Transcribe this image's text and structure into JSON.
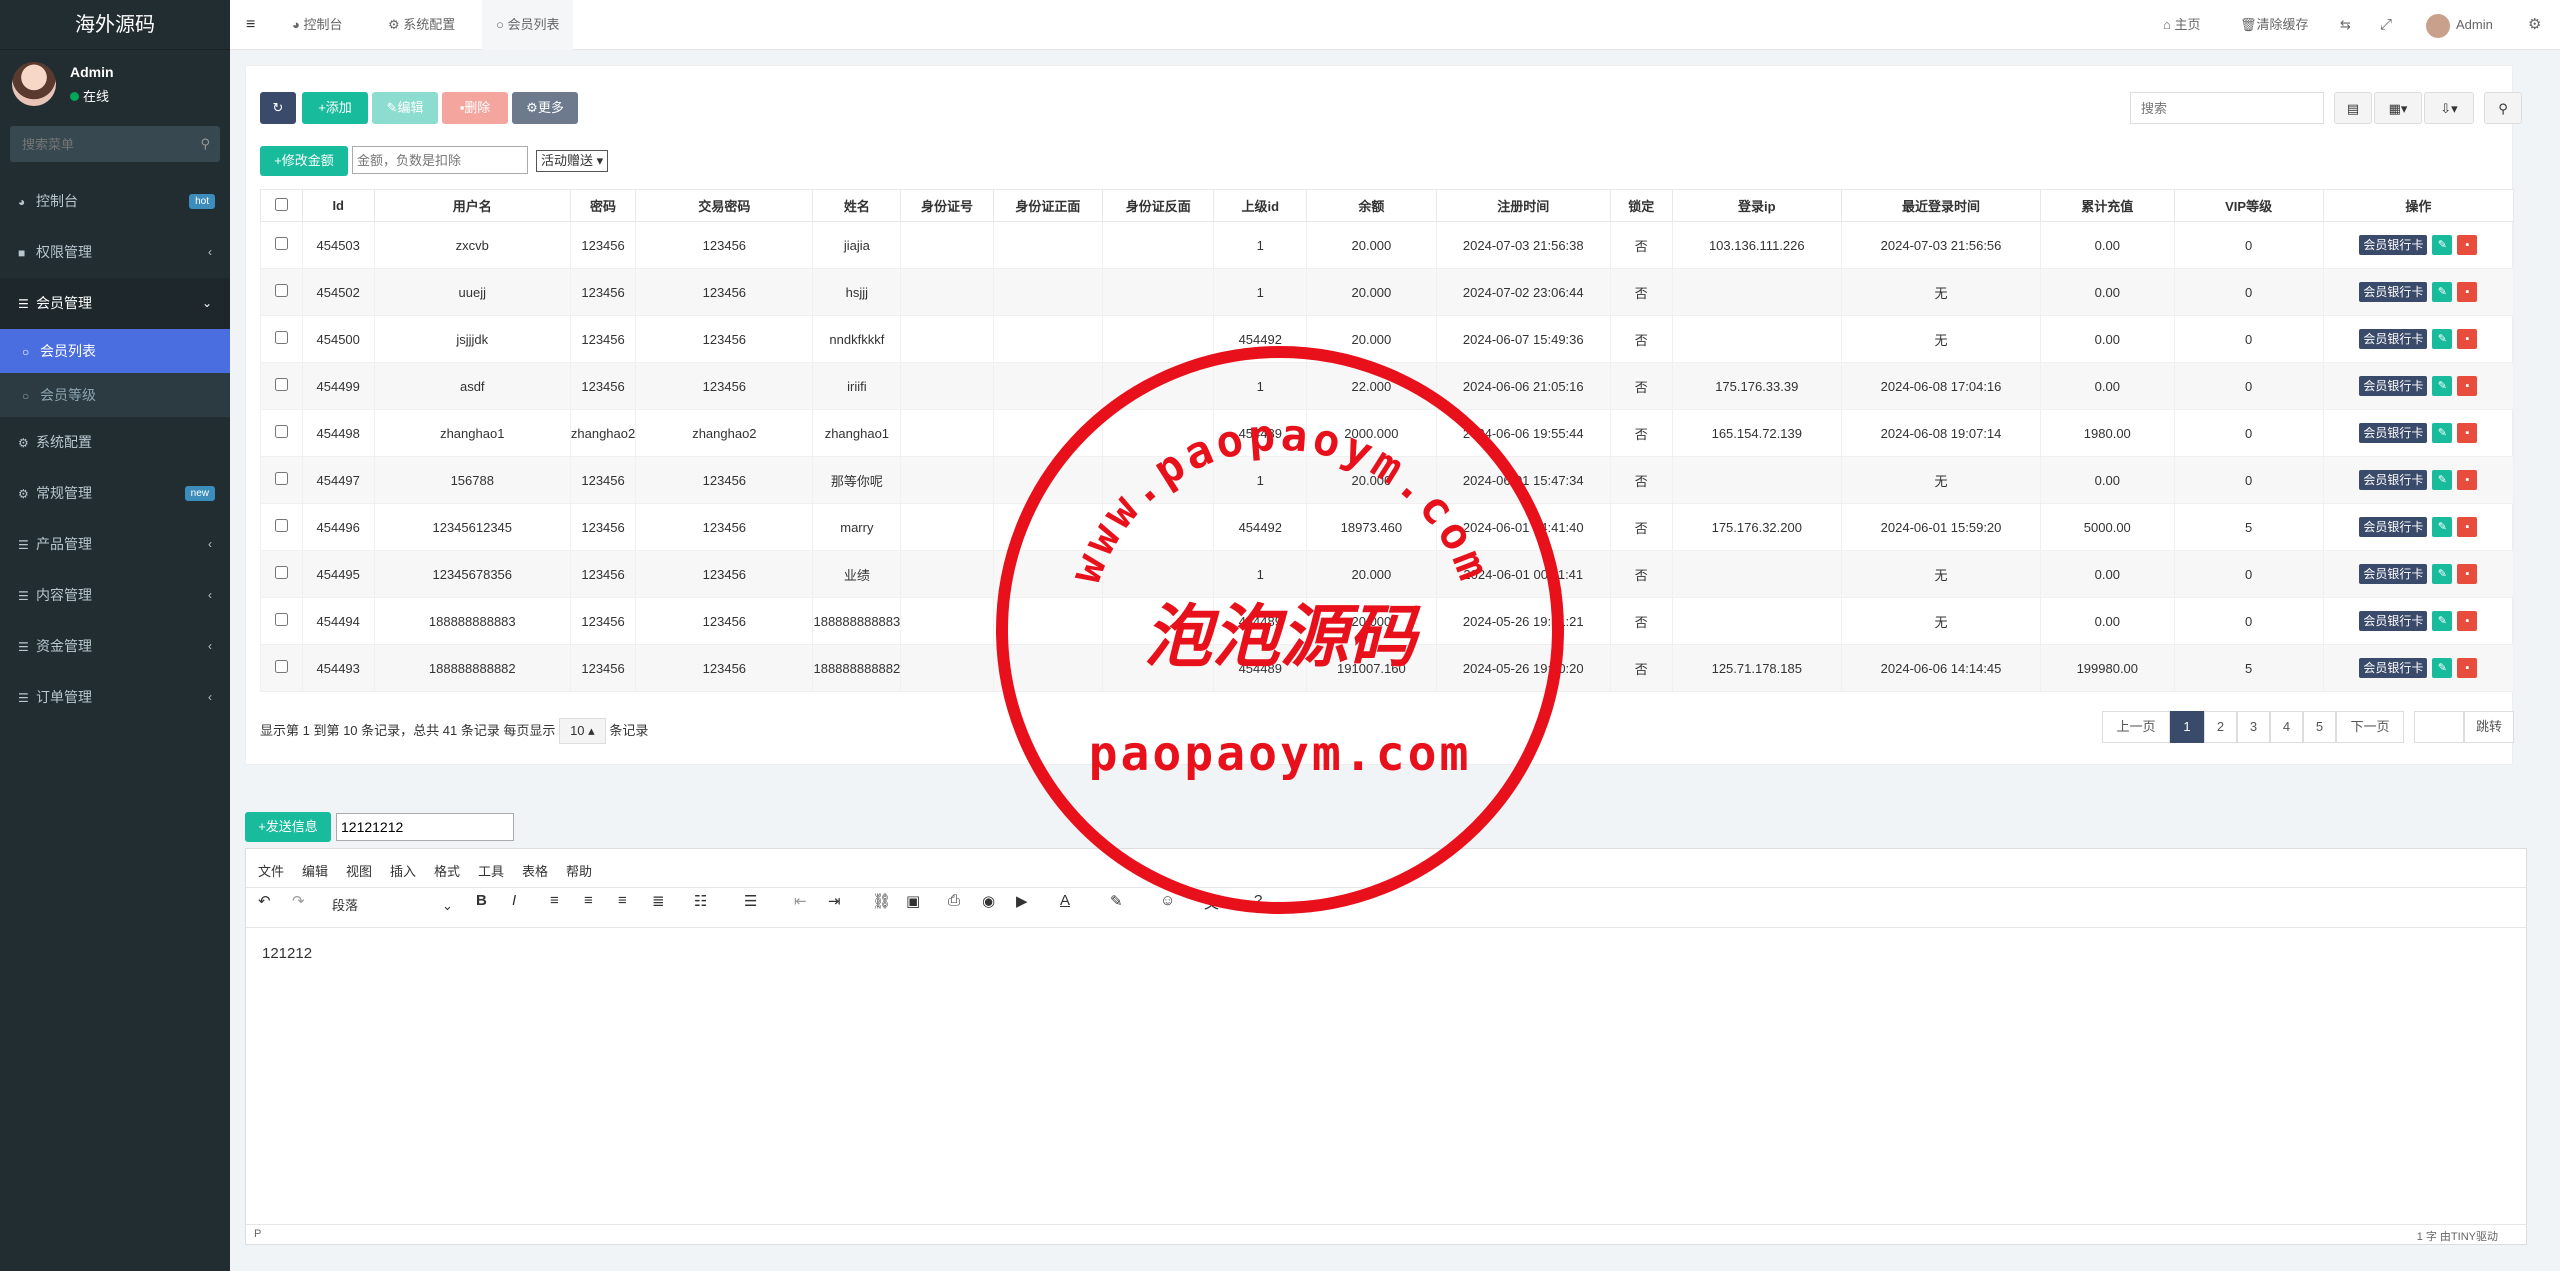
{
  "sidebar": {
    "logo": "海外源码",
    "user": {
      "name": "Admin",
      "status": "在线"
    },
    "search_placeholder": "搜索菜单",
    "items": [
      {
        "label": "控制台",
        "badge": "hot",
        "badge_color": "#3c8dbc"
      },
      {
        "label": "权限管理",
        "arrow": "‹"
      },
      {
        "label": "会员管理",
        "arrow": "⌄"
      },
      {
        "label": "会员列表"
      },
      {
        "label": "会员等级"
      },
      {
        "label": "系统配置"
      },
      {
        "label": "常规管理",
        "badge": "new",
        "badge_color": "#3c8dbc"
      },
      {
        "label": "产品管理",
        "arrow": "‹"
      },
      {
        "label": "内容管理",
        "arrow": "‹"
      },
      {
        "label": "资金管理",
        "arrow": "‹"
      },
      {
        "label": "订单管理",
        "arrow": "‹"
      }
    ]
  },
  "topbar": {
    "tabs": [
      "控制台",
      "系统配置",
      "会员列表"
    ],
    "home": "主页",
    "clear_cache": "清除缓存",
    "admin": "Admin"
  },
  "toolbar": {
    "add": "添加",
    "edit": "编辑",
    "delete": "删除",
    "more": "更多",
    "modify_amount": "修改金额",
    "amount_placeholder": "金额，负数是扣除",
    "activity_select": "活动赠送",
    "search_placeholder": "搜索"
  },
  "table": {
    "headers": [
      "Id",
      "用户名",
      "密码",
      "交易密码",
      "姓名",
      "身份证号",
      "身份证正面",
      "身份证反面",
      "上级id",
      "余额",
      "注册时间",
      "锁定",
      "登录ip",
      "最近登录时间",
      "累计充值",
      "VIP等级",
      "操作"
    ],
    "rows": [
      [
        "454503",
        "zxcvb",
        "123456",
        "123456",
        "jiajia",
        "",
        "",
        "",
        "1",
        "20.000",
        "2024-07-03 21:56:38",
        "否",
        "103.136.111.226",
        "2024-07-03 21:56:56",
        "0.00",
        "0"
      ],
      [
        "454502",
        "uuejj",
        "123456",
        "123456",
        "hsjjj",
        "",
        "",
        "",
        "1",
        "20.000",
        "2024-07-02 23:06:44",
        "否",
        "",
        "无",
        "0.00",
        "0"
      ],
      [
        "454500",
        "jsjjjdk",
        "123456",
        "123456",
        "nndkfkkkf",
        "",
        "",
        "",
        "454492",
        "20.000",
        "2024-06-07 15:49:36",
        "否",
        "",
        "无",
        "0.00",
        "0"
      ],
      [
        "454499",
        "asdf",
        "123456",
        "123456",
        "iriifi",
        "",
        "",
        "",
        "1",
        "22.000",
        "2024-06-06 21:05:16",
        "否",
        "175.176.33.39",
        "2024-06-08 17:04:16",
        "0.00",
        "0"
      ],
      [
        "454498",
        "zhanghao1",
        "zhanghao2",
        "zhanghao2",
        "zhanghao1",
        "",
        "",
        "",
        "454489",
        "2000.000",
        "2024-06-06 19:55:44",
        "否",
        "165.154.72.139",
        "2024-06-08 19:07:14",
        "1980.00",
        "0"
      ],
      [
        "454497",
        "156788",
        "123456",
        "123456",
        "那等你呢",
        "",
        "",
        "",
        "1",
        "20.000",
        "2024-06-01 15:47:34",
        "否",
        "",
        "无",
        "0.00",
        "0"
      ],
      [
        "454496",
        "12345612345",
        "123456",
        "123456",
        "marry",
        "",
        "",
        "",
        "454492",
        "18973.460",
        "2024-06-01 14:41:40",
        "否",
        "175.176.32.200",
        "2024-06-01 15:59:20",
        "5000.00",
        "5"
      ],
      [
        "454495",
        "12345678356",
        "123456",
        "123456",
        "业绩",
        "",
        "",
        "",
        "1",
        "20.000",
        "2024-06-01 00:11:41",
        "否",
        "",
        "无",
        "0.00",
        "0"
      ],
      [
        "454494",
        "188888888883",
        "123456",
        "123456",
        "188888888883",
        "",
        "",
        "",
        "454489",
        "20.000",
        "2024-05-26 19:31:21",
        "否",
        "",
        "无",
        "0.00",
        "0"
      ],
      [
        "454493",
        "188888888882",
        "123456",
        "123456",
        "188888888882",
        "",
        "",
        "",
        "454489",
        "191007.160",
        "2024-05-26 19:30:20",
        "否",
        "125.71.178.185",
        "2024-06-06 14:14:45",
        "199980.00",
        "5"
      ]
    ],
    "op_label": "会员银行卡"
  },
  "pagination": {
    "summary": "显示第 1 到第 10 条记录，总共 41 条记录 每页显示",
    "page_size": "10",
    "suffix": "条记录",
    "prev": "上一页",
    "pages": [
      "1",
      "2",
      "3",
      "4",
      "5"
    ],
    "next": "下一页",
    "jump": "跳转"
  },
  "message": {
    "send": "发送信息",
    "input_value": "12121212"
  },
  "editor": {
    "menus": [
      "文件",
      "编辑",
      "视图",
      "插入",
      "格式",
      "工具",
      "表格",
      "帮助"
    ],
    "block": "段落",
    "content": "121212",
    "status_left": "P",
    "status_right": "1 字  由TINY驱动"
  },
  "watermark": {
    "arc_text": "www.paopaoym.com",
    "center": "泡泡源码",
    "bottom": "paopaoym.com",
    "color": "#e8101a"
  }
}
